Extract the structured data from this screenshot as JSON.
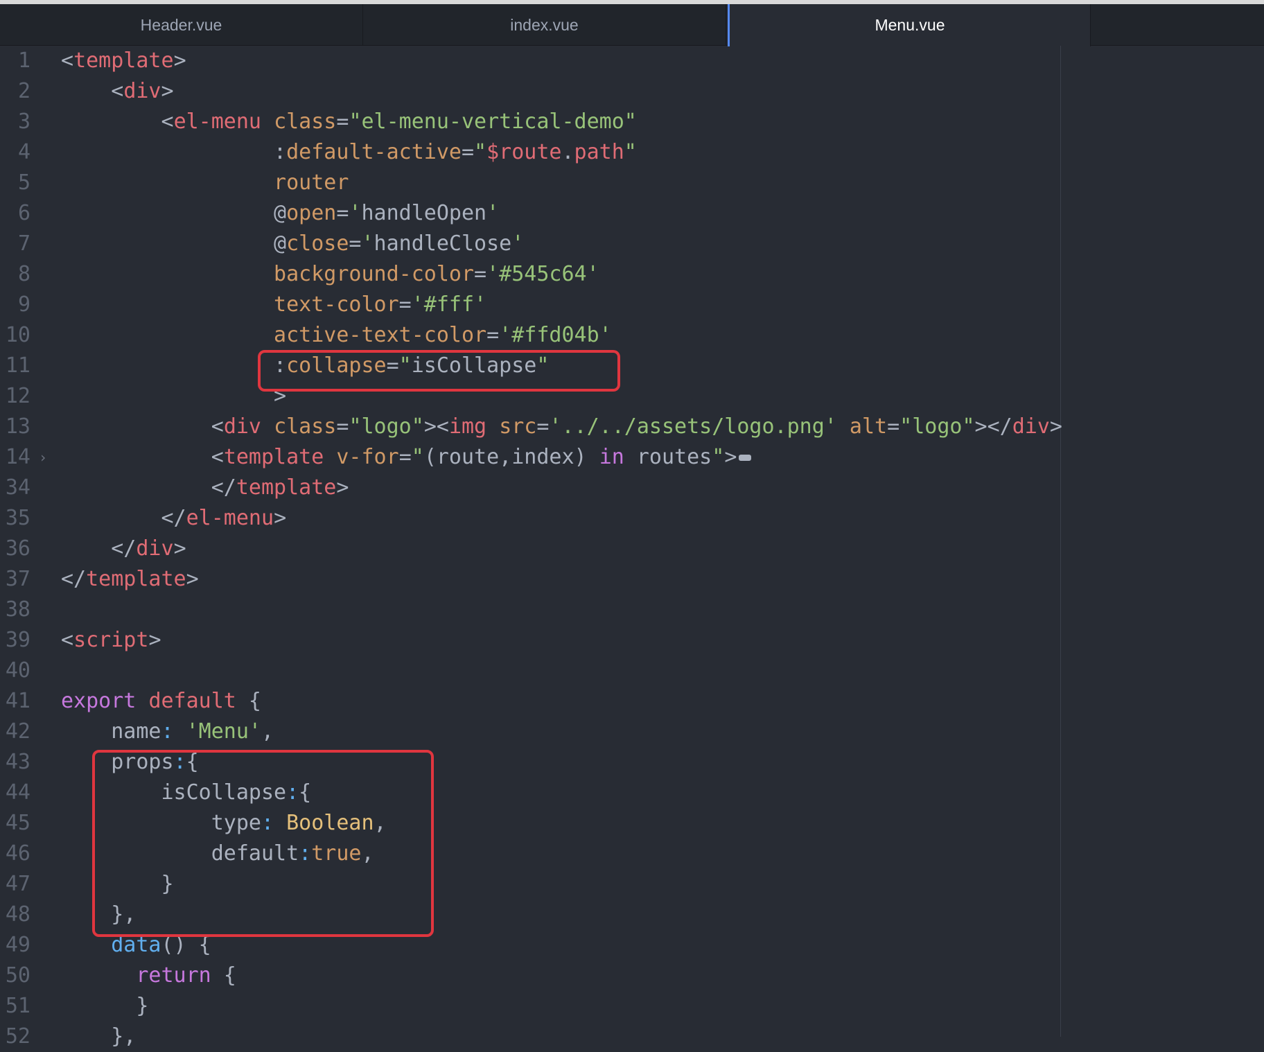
{
  "tabs": [
    {
      "label": "Header.vue",
      "active": false
    },
    {
      "label": "index.vue",
      "active": false
    },
    {
      "label": "Menu.vue",
      "active": true
    }
  ],
  "editor": {
    "lines": [
      {
        "n": "1",
        "tokens": [
          [
            "p",
            "<"
          ],
          [
            "t",
            "template"
          ],
          [
            "p",
            ">"
          ]
        ]
      },
      {
        "n": "2",
        "tokens": [
          [
            "p",
            "    <"
          ],
          [
            "t",
            "div"
          ],
          [
            "p",
            ">"
          ]
        ]
      },
      {
        "n": "3",
        "tokens": [
          [
            "p",
            "        <"
          ],
          [
            "t",
            "el-menu"
          ],
          [
            "p",
            " "
          ],
          [
            "a",
            "class"
          ],
          [
            "p",
            "="
          ],
          [
            "s",
            "\"el-menu-vertical-demo\""
          ]
        ]
      },
      {
        "n": "4",
        "tokens": [
          [
            "p",
            "                 :"
          ],
          [
            "a",
            "default-active"
          ],
          [
            "p",
            "="
          ],
          [
            "s",
            "\""
          ],
          [
            "t",
            "$route"
          ],
          [
            "p",
            "."
          ],
          [
            "t",
            "path"
          ],
          [
            "s",
            "\""
          ]
        ]
      },
      {
        "n": "5",
        "tokens": [
          [
            "p",
            "                 "
          ],
          [
            "a",
            "router"
          ]
        ]
      },
      {
        "n": "6",
        "tokens": [
          [
            "p",
            "                 @"
          ],
          [
            "a",
            "open"
          ],
          [
            "p",
            "="
          ],
          [
            "s",
            "'"
          ],
          [
            "p",
            "handleOpen"
          ],
          [
            "s",
            "'"
          ]
        ]
      },
      {
        "n": "7",
        "tokens": [
          [
            "p",
            "                 @"
          ],
          [
            "a",
            "close"
          ],
          [
            "p",
            "="
          ],
          [
            "s",
            "'"
          ],
          [
            "p",
            "handleClose"
          ],
          [
            "s",
            "'"
          ]
        ]
      },
      {
        "n": "8",
        "tokens": [
          [
            "p",
            "                 "
          ],
          [
            "a",
            "background-color"
          ],
          [
            "p",
            "="
          ],
          [
            "s",
            "'#545c64'"
          ]
        ]
      },
      {
        "n": "9",
        "tokens": [
          [
            "p",
            "                 "
          ],
          [
            "a",
            "text-color"
          ],
          [
            "p",
            "="
          ],
          [
            "s",
            "'#fff'"
          ]
        ]
      },
      {
        "n": "10",
        "tokens": [
          [
            "p",
            "                 "
          ],
          [
            "a",
            "active-text-color"
          ],
          [
            "p",
            "="
          ],
          [
            "s",
            "'#ffd04b'"
          ]
        ]
      },
      {
        "n": "11",
        "tokens": [
          [
            "p",
            "                 :"
          ],
          [
            "a",
            "collapse"
          ],
          [
            "p",
            "="
          ],
          [
            "s",
            "\""
          ],
          [
            "p",
            "isCollapse"
          ],
          [
            "s",
            "\""
          ]
        ]
      },
      {
        "n": "12",
        "tokens": [
          [
            "p",
            "                 >"
          ]
        ]
      },
      {
        "n": "13",
        "tokens": [
          [
            "p",
            "            <"
          ],
          [
            "t",
            "div"
          ],
          [
            "p",
            " "
          ],
          [
            "a",
            "class"
          ],
          [
            "p",
            "="
          ],
          [
            "s",
            "\"logo\""
          ],
          [
            "p",
            "><"
          ],
          [
            "t",
            "img"
          ],
          [
            "p",
            " "
          ],
          [
            "a",
            "src"
          ],
          [
            "p",
            "="
          ],
          [
            "s",
            "'../../assets/logo.png'"
          ],
          [
            "p",
            " "
          ],
          [
            "a",
            "alt"
          ],
          [
            "p",
            "="
          ],
          [
            "s",
            "\"logo\""
          ],
          [
            "p",
            "></"
          ],
          [
            "t",
            "div"
          ],
          [
            "p",
            ">"
          ]
        ]
      },
      {
        "n": "14",
        "fold": "›",
        "collapsed": true,
        "tokens": [
          [
            "p",
            "            <"
          ],
          [
            "t",
            "template"
          ],
          [
            "p",
            " "
          ],
          [
            "a",
            "v-for"
          ],
          [
            "p",
            "="
          ],
          [
            "s",
            "\""
          ],
          [
            "p",
            "(route,index) "
          ],
          [
            "k",
            "in"
          ],
          [
            "p",
            " routes"
          ],
          [
            "s",
            "\""
          ],
          [
            "p",
            ">"
          ]
        ]
      },
      {
        "n": "34",
        "tokens": [
          [
            "p",
            "            </"
          ],
          [
            "t",
            "template"
          ],
          [
            "p",
            ">"
          ]
        ]
      },
      {
        "n": "35",
        "tokens": [
          [
            "p",
            "        </"
          ],
          [
            "t",
            "el-menu"
          ],
          [
            "p",
            ">"
          ]
        ]
      },
      {
        "n": "36",
        "tokens": [
          [
            "p",
            "    </"
          ],
          [
            "t",
            "div"
          ],
          [
            "p",
            ">"
          ]
        ]
      },
      {
        "n": "37",
        "tokens": [
          [
            "p",
            "</"
          ],
          [
            "t",
            "template"
          ],
          [
            "p",
            ">"
          ]
        ]
      },
      {
        "n": "38",
        "tokens": []
      },
      {
        "n": "39",
        "tokens": [
          [
            "p",
            "<"
          ],
          [
            "t",
            "script"
          ],
          [
            "p",
            ">"
          ]
        ]
      },
      {
        "n": "40",
        "tokens": []
      },
      {
        "n": "41",
        "tokens": [
          [
            "k",
            "export"
          ],
          [
            "p",
            " "
          ],
          [
            "t",
            "default"
          ],
          [
            "p",
            " {"
          ]
        ]
      },
      {
        "n": "42",
        "tokens": [
          [
            "p",
            "    name"
          ],
          [
            "f",
            ":"
          ],
          [
            "p",
            " "
          ],
          [
            "s",
            "'Menu'"
          ],
          [
            "p",
            ","
          ]
        ]
      },
      {
        "n": "43",
        "tokens": [
          [
            "p",
            "    props"
          ],
          [
            "f",
            ":"
          ],
          [
            "p",
            "{"
          ]
        ]
      },
      {
        "n": "44",
        "tokens": [
          [
            "p",
            "        isCollapse"
          ],
          [
            "f",
            ":"
          ],
          [
            "p",
            "{"
          ]
        ]
      },
      {
        "n": "45",
        "tokens": [
          [
            "p",
            "            type"
          ],
          [
            "f",
            ":"
          ],
          [
            "p",
            " "
          ],
          [
            "y",
            "Boolean"
          ],
          [
            "p",
            ","
          ]
        ]
      },
      {
        "n": "46",
        "tokens": [
          [
            "p",
            "            default"
          ],
          [
            "f",
            ":"
          ],
          [
            "a",
            "true"
          ],
          [
            "p",
            ","
          ]
        ]
      },
      {
        "n": "47",
        "tokens": [
          [
            "p",
            "        }"
          ]
        ]
      },
      {
        "n": "48",
        "tokens": [
          [
            "p",
            "    },"
          ]
        ]
      },
      {
        "n": "49",
        "tokens": [
          [
            "p",
            "    "
          ],
          [
            "f",
            "data"
          ],
          [
            "p",
            "() {"
          ]
        ]
      },
      {
        "n": "50",
        "tokens": [
          [
            "p",
            "      "
          ],
          [
            "k",
            "return"
          ],
          [
            "p",
            " {"
          ]
        ]
      },
      {
        "n": "51",
        "tokens": [
          [
            "p",
            "      }"
          ]
        ]
      },
      {
        "n": "52",
        "tokens": [
          [
            "p",
            "    },"
          ]
        ]
      }
    ]
  },
  "highlights": [
    {
      "label": "collapse-attribute-highlight"
    },
    {
      "label": "props-block-highlight"
    }
  ]
}
